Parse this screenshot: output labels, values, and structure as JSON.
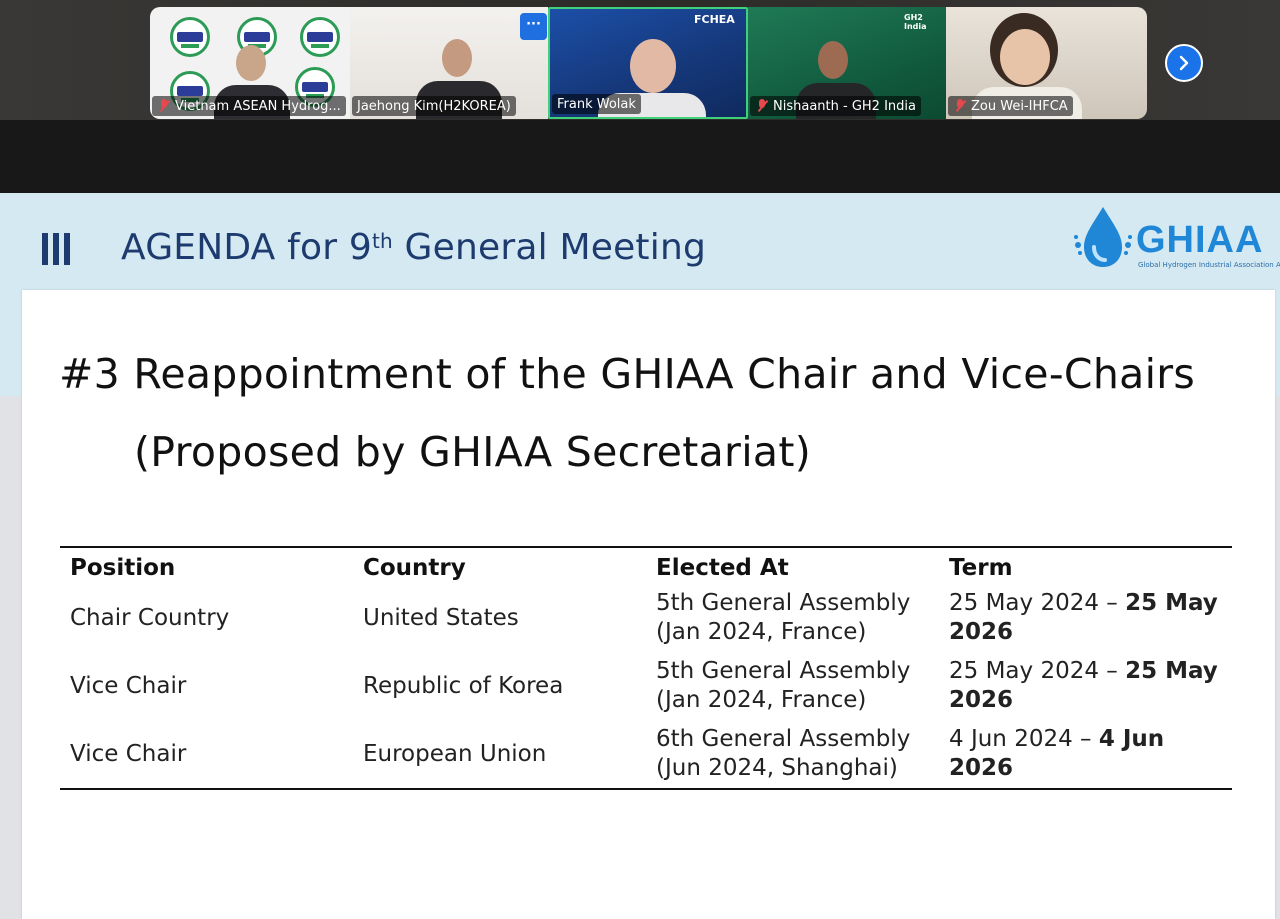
{
  "participants": [
    {
      "name": "Vietnam ASEAN Hydrog...",
      "muted": true,
      "active": false
    },
    {
      "name": "Jaehong Kim(H2KOREA)",
      "muted": false,
      "active": false
    },
    {
      "name": "Frank Wolak",
      "muted": false,
      "active": true
    },
    {
      "name": "Nishaanth - GH2 India",
      "muted": true,
      "active": false
    },
    {
      "name": "Zou Wei-IHFCA",
      "muted": true,
      "active": false
    }
  ],
  "tile_brands": {
    "fchea": "FCHEA",
    "gh2": "GH2 India"
  },
  "controls": {
    "more": "···",
    "next_icon": "chevron-right-icon"
  },
  "slide": {
    "agenda_title": "AGENDA for 9",
    "agenda_title_sup": "th",
    "agenda_title_rest": " General Meeting",
    "logo": {
      "word": "GHIAA",
      "subtitle": "Global Hydrogen Industrial Association Alliance"
    },
    "heading_line1": "#3 Reappointment of the GHIAA Chair and Vice-Chairs",
    "heading_line2": "(Proposed by GHIAA Secretariat)",
    "table": {
      "headers": [
        "Position",
        "Country",
        "Elected At",
        "Term"
      ],
      "rows": [
        {
          "position": "Chair Country",
          "country": "United States",
          "elected": "5th General Assembly (Jan 2024, France)",
          "term_start": "25 May 2024 – ",
          "term_end": "25 May 2026"
        },
        {
          "position": "Vice Chair",
          "country": "Republic of Korea",
          "elected": "5th General Assembly (Jan 2024, France)",
          "term_start": "25 May 2024 – ",
          "term_end": "25 May 2026"
        },
        {
          "position": "Vice Chair",
          "country": "European Union",
          "elected": "6th General Assembly (Jun 2024, Shanghai)",
          "term_start": "4 Jun 2024 – ",
          "term_end": "4 Jun 2026"
        }
      ]
    }
  },
  "colors": {
    "accent": "#1d3b6e",
    "active_border": "#3fd17a",
    "muted_mic": "#e5484d",
    "logo_blue": "#1f87d6"
  }
}
